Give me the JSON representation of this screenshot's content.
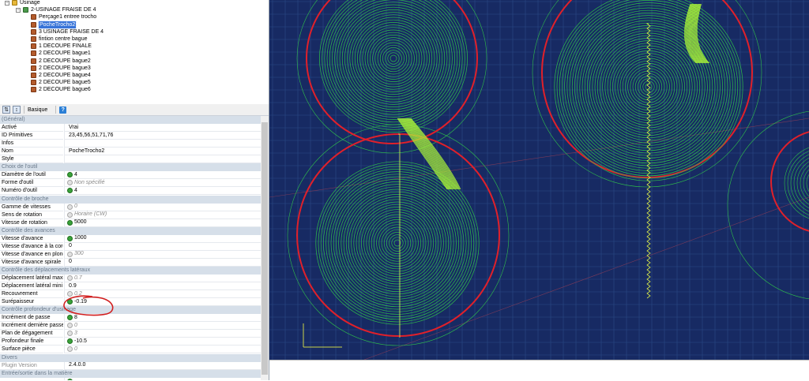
{
  "tree": {
    "items": [
      {
        "label": "Usinage",
        "icon": "folder-icon"
      },
      {
        "label": "2-USINAGE FRAISE DE 4",
        "icon": "operation-group-icon"
      },
      {
        "label": "Perçage1 entree trocho",
        "icon": "operation-icon"
      },
      {
        "label": "PocheTrocho2",
        "icon": "operation-icon",
        "selected": true
      },
      {
        "label": "3 USINAGE FRAISE DE 4",
        "icon": "operation-icon"
      },
      {
        "label": "fintion centre bague",
        "icon": "operation-icon"
      },
      {
        "label": "1 DECOUPE FINALE",
        "icon": "operation-icon"
      },
      {
        "label": "2 DECOUPE bague1",
        "icon": "operation-icon"
      },
      {
        "label": "2 DECOUPE bague2",
        "icon": "operation-icon"
      },
      {
        "label": "2 DECOUPE bague3",
        "icon": "operation-icon"
      },
      {
        "label": "2 DECOUPE bague4",
        "icon": "operation-icon"
      },
      {
        "label": "2 DECOUPE bague5",
        "icon": "operation-icon"
      },
      {
        "label": "2 DECOUPE bague6",
        "icon": "operation-icon"
      }
    ]
  },
  "toolbar": {
    "sort_icon": "sort-alphabetical-icon",
    "basic_label": "Basique",
    "help_icon": "help-icon"
  },
  "properties": [
    {
      "type": "cat",
      "label": "(Général)"
    },
    {
      "type": "prop",
      "label": "Activé",
      "value": "Vrai"
    },
    {
      "type": "prop",
      "label": "ID Primitives",
      "value": "23,45,56,51,71,76"
    },
    {
      "type": "prop",
      "label": "Infos",
      "value": ""
    },
    {
      "type": "prop",
      "label": "Nom",
      "value": "PocheTrocho2"
    },
    {
      "type": "prop",
      "label": "Style",
      "value": ""
    },
    {
      "type": "cat",
      "label": "Choix de l'outil"
    },
    {
      "type": "prop",
      "label": "Diamètre de l'outil",
      "value": "4",
      "badge": "on"
    },
    {
      "type": "prop",
      "label": "Forme d'outil",
      "value": "Non spécifié",
      "badge": "off",
      "italic": true
    },
    {
      "type": "prop",
      "label": "Numéro d'outil",
      "value": "4",
      "badge": "on"
    },
    {
      "type": "cat",
      "label": "Contrôle de broche"
    },
    {
      "type": "prop",
      "label": "Gamme de vitesses",
      "value": "0",
      "badge": "off",
      "italic": true
    },
    {
      "type": "prop",
      "label": "Sens de rotation",
      "value": "Horaire (CW)",
      "badge": "off",
      "italic": true
    },
    {
      "type": "prop",
      "label": "Vitesse de rotation",
      "value": "5000",
      "badge": "on"
    },
    {
      "type": "cat",
      "label": "Contrôle des avances"
    },
    {
      "type": "prop",
      "label": "Vitesse d'avance",
      "value": "1000",
      "badge": "on"
    },
    {
      "type": "prop",
      "label": "Vitesse d'avance à la corde",
      "value": "0"
    },
    {
      "type": "prop",
      "label": "Vitesse d'avance en plongée",
      "value": "300",
      "badge": "off",
      "italic": true
    },
    {
      "type": "prop",
      "label": "Vitesse d'avance spirale",
      "value": "0"
    },
    {
      "type": "cat",
      "label": "Contrôle des déplacements latéraux"
    },
    {
      "type": "prop",
      "label": "Déplacement latéral maxi",
      "value": "0.7",
      "badge": "off",
      "italic": true
    },
    {
      "type": "prop",
      "label": "Déplacement latéral mini",
      "value": "0.9"
    },
    {
      "type": "prop",
      "label": "Recouvrement",
      "value": "0.2",
      "badge": "off",
      "italic": true
    },
    {
      "type": "prop",
      "label": "Surépaisseur",
      "value": "-0.19",
      "badge": "on"
    },
    {
      "type": "cat",
      "label": "Contrôle profondeur d'usinage"
    },
    {
      "type": "prop",
      "label": "Incrément de passe",
      "value": "8",
      "badge": "on"
    },
    {
      "type": "prop",
      "label": "Incrément dernière passe",
      "value": "0",
      "badge": "off",
      "italic": true
    },
    {
      "type": "prop",
      "label": "Plan de dégagement",
      "value": "3",
      "badge": "off",
      "italic": true
    },
    {
      "type": "prop",
      "label": "Profondeur finale",
      "value": "-10.5",
      "badge": "on"
    },
    {
      "type": "prop",
      "label": "Surface pièce",
      "value": "0",
      "badge": "off",
      "italic": true
    },
    {
      "type": "cat",
      "label": "Divers"
    },
    {
      "type": "prop",
      "label": "Plugin Version",
      "value": "2.4.0.0",
      "grey": true
    },
    {
      "type": "cat",
      "label": "Entrée/sortie dans la matière"
    },
    {
      "type": "prop",
      "label": "",
      "value": "",
      "badge": "on"
    }
  ],
  "colors": {
    "canvas_bg": "#172a63",
    "grid": "#2c4a86",
    "outline": "#e0202a",
    "toolpath": "#2fbf4a",
    "annotation": "#d21f1f"
  }
}
